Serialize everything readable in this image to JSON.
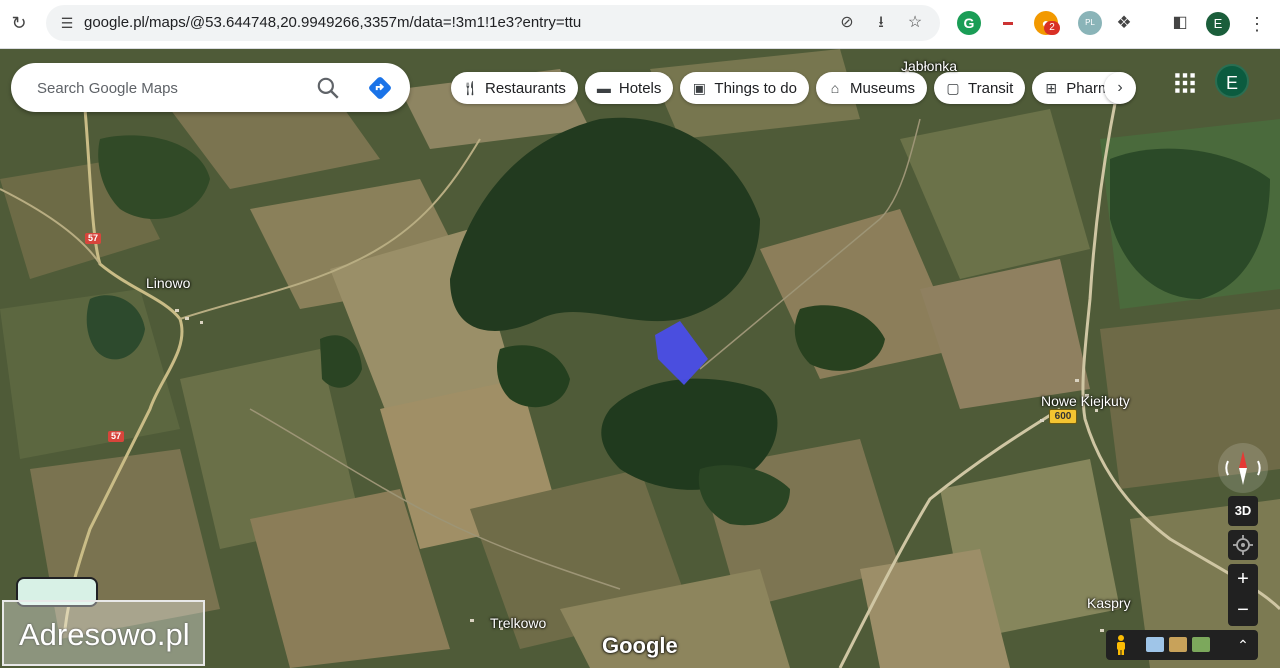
{
  "browser": {
    "url": "google.pl/maps/@53.644748,20.9949266,3357m/data=!3m1!1e3?entry=ttu",
    "extension_badge": "2",
    "profile_initial": "E",
    "pl_badge": "PL"
  },
  "map": {
    "search_placeholder": "Search Google Maps",
    "chips": [
      {
        "label": "Restaurants",
        "icon": "utensils-icon"
      },
      {
        "label": "Hotels",
        "icon": "bed-icon"
      },
      {
        "label": "Things to do",
        "icon": "camera-icon"
      },
      {
        "label": "Museums",
        "icon": "museum-icon"
      },
      {
        "label": "Transit",
        "icon": "train-icon"
      },
      {
        "label": "Pharm",
        "icon": "pharmacy-icon"
      }
    ],
    "account_initial": "E",
    "places": {
      "jablonka": "Jabłonka",
      "linowo": "Linowo",
      "nowe_kiejkuty": "Nowe Kiejkuty",
      "trelkowo": "Trelkowo",
      "kaspry": "Kaspry"
    },
    "roads": {
      "r57a": "57",
      "r57b": "57",
      "r600": "600"
    },
    "view_3d_label": "3D",
    "zoom_in_label": "+",
    "zoom_out_label": "−",
    "logo_text": "Google",
    "highlight_color": "#4a4ee8"
  },
  "watermark": "Adresowo.pl"
}
